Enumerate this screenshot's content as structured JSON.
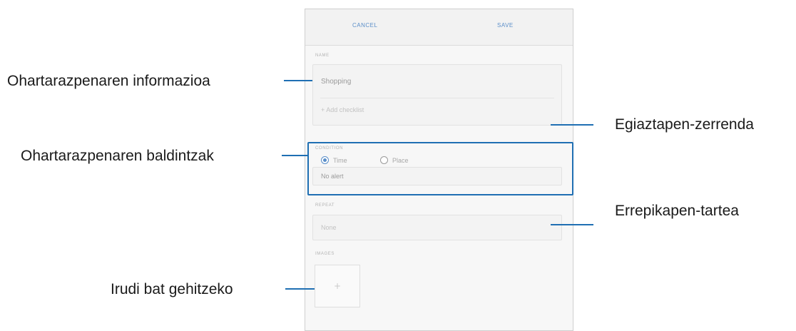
{
  "topbar": {
    "cancel_label": "CANCEL",
    "save_label": "SAVE"
  },
  "reminder": {
    "name_label": "NAME",
    "name_value": "Shopping",
    "checklist_placeholder": "+ Add checklist",
    "condition_label": "CONDITION",
    "option_time": "Time",
    "option_place": "Place",
    "alert_value": "No alert",
    "repeat_label": "REPEAT",
    "repeat_value": "None",
    "images_label": "IMAGES",
    "add_image_symbol": "+"
  },
  "callouts": {
    "info": "Ohartarazpenaren informazioa",
    "conditions": "Ohartarazpenaren baldintzak",
    "add_image": "Irudi bat gehitzeko",
    "checklist": "Egiaztapen-zerrenda",
    "repeat": "Errepikapen-tartea"
  },
  "colors": {
    "accent": "#1f6fb3",
    "link": "#5b8fc9"
  },
  "icons": {
    "radio_selected": "radio-selected-icon",
    "radio_unselected": "radio-unselected-icon",
    "add": "plus-icon"
  }
}
